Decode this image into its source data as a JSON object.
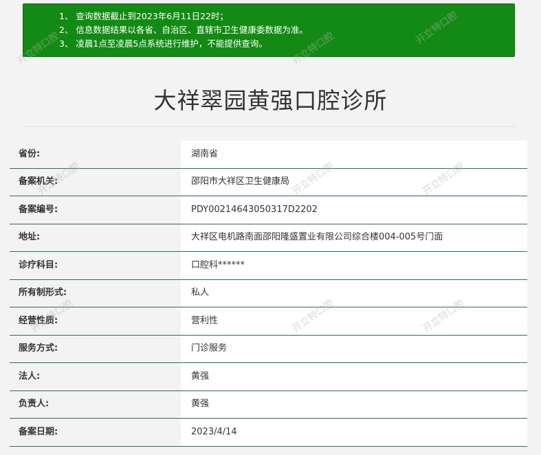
{
  "notice": {
    "lines": [
      "1、 查询数据截止到2023年6月11日22时；",
      "2、 信息数据结果以各省、自治区、直辖市卫生健康委数据为准。",
      "3、 凌晨1点至凌晨5点系统进行维护，不能提供查询。"
    ]
  },
  "title": "大祥翠园黄强口腔诊所",
  "rows": [
    {
      "label": "省份:",
      "value": "湖南省"
    },
    {
      "label": "备案机关:",
      "value": "邵阳市大祥区卫生健康局"
    },
    {
      "label": "备案编号:",
      "value": "PDY00214643050317D2202"
    },
    {
      "label": "地址:",
      "value": "大祥区电机路南面邵阳隆盛置业有限公司综合楼004-005号门面"
    },
    {
      "label": "诊疗科目:",
      "value": "口腔科******"
    },
    {
      "label": "所有制形式:",
      "value": "私人"
    },
    {
      "label": "经营性质:",
      "value": "营利性"
    },
    {
      "label": "服务方式:",
      "value": "门诊服务"
    },
    {
      "label": "法人:",
      "value": "黄强"
    },
    {
      "label": "负责人:",
      "value": "黄强"
    },
    {
      "label": "备案日期:",
      "value": "2023/4/14"
    }
  ],
  "watermark_text": "开立特口腔",
  "colors": {
    "notice_bg": "#138a13",
    "row_border": "#2e6b4e",
    "page_bg": "#f3f3f3"
  }
}
